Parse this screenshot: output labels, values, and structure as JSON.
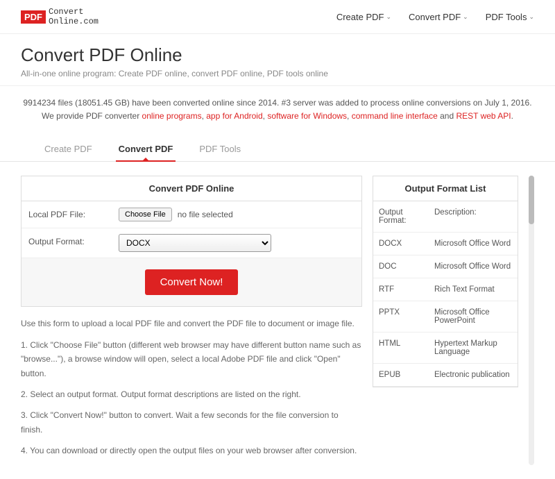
{
  "logo": {
    "badge": "PDF",
    "line1": "Convert",
    "line2": "Online.com"
  },
  "topnav": [
    {
      "label": "Create PDF"
    },
    {
      "label": "Convert PDF"
    },
    {
      "label": "PDF Tools"
    }
  ],
  "title": "Convert PDF Online",
  "subtitle": "All-in-one online program: Create PDF online, convert PDF online, PDF tools online",
  "stats": {
    "line1": "9914234 files (18051.45 GB) have been converted online since 2014. #3 server was added to process online conversions on July 1, 2016.",
    "prefix": "We provide PDF converter ",
    "links": [
      "online programs",
      "app for Android",
      "software for Windows",
      "command line interface"
    ],
    "and": " and ",
    "last": "REST web API",
    "period": "."
  },
  "tabs": [
    {
      "label": "Create PDF",
      "active": false
    },
    {
      "label": "Convert PDF",
      "active": true
    },
    {
      "label": "PDF Tools",
      "active": false
    }
  ],
  "form": {
    "heading": "Convert PDF Online",
    "file_label": "Local PDF File:",
    "choose_label": "Choose File",
    "nofile_text": "no file selected",
    "format_label": "Output Format:",
    "format_value": "DOCX",
    "convert_label": "Convert Now!"
  },
  "instructions": {
    "intro": "Use this form to upload a local PDF file and convert the PDF file to document or image file.",
    "steps": [
      "1. Click \"Choose File\" button (different web browser may have different button name such as \"browse...\"), a browse window will open, select a local Adobe PDF file and click \"Open\" button.",
      "2. Select an output format. Output format descriptions are listed on the right.",
      "3. Click \"Convert Now!\" button to convert. Wait a few seconds for the file conversion to finish.",
      "4. You can download or directly open the output files on your web browser after conversion."
    ]
  },
  "formats": {
    "heading": "Output Format List",
    "header": {
      "c1": "Output Format:",
      "c2": "Description:"
    },
    "rows": [
      {
        "c1": "DOCX",
        "c2": "Microsoft Office Word"
      },
      {
        "c1": "DOC",
        "c2": "Microsoft Office Word"
      },
      {
        "c1": "RTF",
        "c2": "Rich Text Format"
      },
      {
        "c1": "PPTX",
        "c2": "Microsoft Office PowerPoint"
      },
      {
        "c1": "HTML",
        "c2": "Hypertext Markup Language"
      },
      {
        "c1": "EPUB",
        "c2": "Electronic publication"
      }
    ]
  }
}
